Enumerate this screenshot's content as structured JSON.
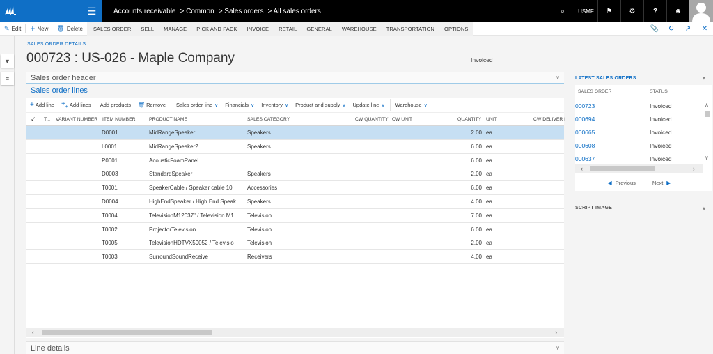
{
  "topbar": {
    "breadcrumb": [
      "Accounts receivable",
      "> Common",
      "> Sales orders",
      "> All sales orders"
    ],
    "company": "USMF",
    "icons": [
      "search-icon",
      "flag-icon",
      "gear-icon",
      "help-icon",
      "smiley-icon"
    ]
  },
  "actionbar": {
    "edit": "Edit",
    "new": "New",
    "delete": "Delete",
    "tabs": [
      "SALES ORDER",
      "SELL",
      "MANAGE",
      "PICK AND PACK",
      "INVOICE",
      "RETAIL",
      "GENERAL",
      "WAREHOUSE",
      "TRANSPORTATION",
      "OPTIONS"
    ],
    "right_icons": [
      "attach-icon",
      "refresh-icon",
      "open-new-window-icon",
      "close-icon"
    ]
  },
  "page": {
    "caption": "SALES ORDER DETAILS",
    "title": "000723 : US-026 - Maple Company",
    "status": "Invoiced"
  },
  "sections": {
    "header": "Sales order header",
    "lines": "Sales order lines",
    "line_details": "Line details"
  },
  "grid_toolbar": {
    "add_line": "Add line",
    "add_lines": "Add lines",
    "add_products": "Add products",
    "remove": "Remove",
    "menus": [
      "Sales order line",
      "Financials",
      "Inventory",
      "Product and supply",
      "Update line",
      "Warehouse"
    ]
  },
  "grid": {
    "columns": [
      "T...",
      "VARIANT NUMBER",
      "ITEM NUMBER",
      "PRODUCT NAME",
      "SALES CATEGORY",
      "CW QUANTITY",
      "CW UNIT",
      "QUANTITY",
      "UNIT",
      "CW DELIVER I"
    ],
    "rows": [
      {
        "item": "D0001",
        "product": "MidRangeSpeaker",
        "category": "Speakers",
        "quantity": "2.00",
        "unit": "ea",
        "selected": true
      },
      {
        "item": "L0001",
        "product": "MidRangeSpeaker2",
        "category": "Speakers",
        "quantity": "6.00",
        "unit": "ea"
      },
      {
        "item": "P0001",
        "product": "AcousticFoamPanel",
        "category": "",
        "quantity": "6.00",
        "unit": "ea"
      },
      {
        "item": "D0003",
        "product": "StandardSpeaker",
        "category": "Speakers",
        "quantity": "2.00",
        "unit": "ea"
      },
      {
        "item": "T0001",
        "product": "SpeakerCable / Speaker cable 10",
        "category": "Accessories",
        "quantity": "6.00",
        "unit": "ea"
      },
      {
        "item": "D0004",
        "product": "HighEndSpeaker / High End Speak",
        "category": "Speakers",
        "quantity": "4.00",
        "unit": "ea"
      },
      {
        "item": "T0004",
        "product": "TelevisionM12037\" / Television M1",
        "category": "Television",
        "quantity": "7.00",
        "unit": "ea"
      },
      {
        "item": "T0002",
        "product": "ProjectorTelevision",
        "category": "Television",
        "quantity": "6.00",
        "unit": "ea"
      },
      {
        "item": "T0005",
        "product": "TelevisionHDTVX59052 / Televisio",
        "category": "Television",
        "quantity": "2.00",
        "unit": "ea"
      },
      {
        "item": "T0003",
        "product": "SurroundSoundReceive",
        "category": "Receivers",
        "quantity": "4.00",
        "unit": "ea"
      }
    ]
  },
  "right_panel": {
    "title": "LATEST SALES ORDERS",
    "columns": [
      "SALES ORDER",
      "STATUS"
    ],
    "rows": [
      {
        "order": "000723",
        "status": "Invoiced"
      },
      {
        "order": "000694",
        "status": "Invoiced"
      },
      {
        "order": "000665",
        "status": "Invoiced"
      },
      {
        "order": "000608",
        "status": "Invoiced"
      },
      {
        "order": "000637",
        "status": "Invoiced"
      }
    ],
    "previous": "Previous",
    "next": "Next",
    "script_image": "SCRIPT IMAGE"
  },
  "colors": {
    "brand_blue": "#0f6fc6",
    "selected_row": "#c6dff3"
  }
}
